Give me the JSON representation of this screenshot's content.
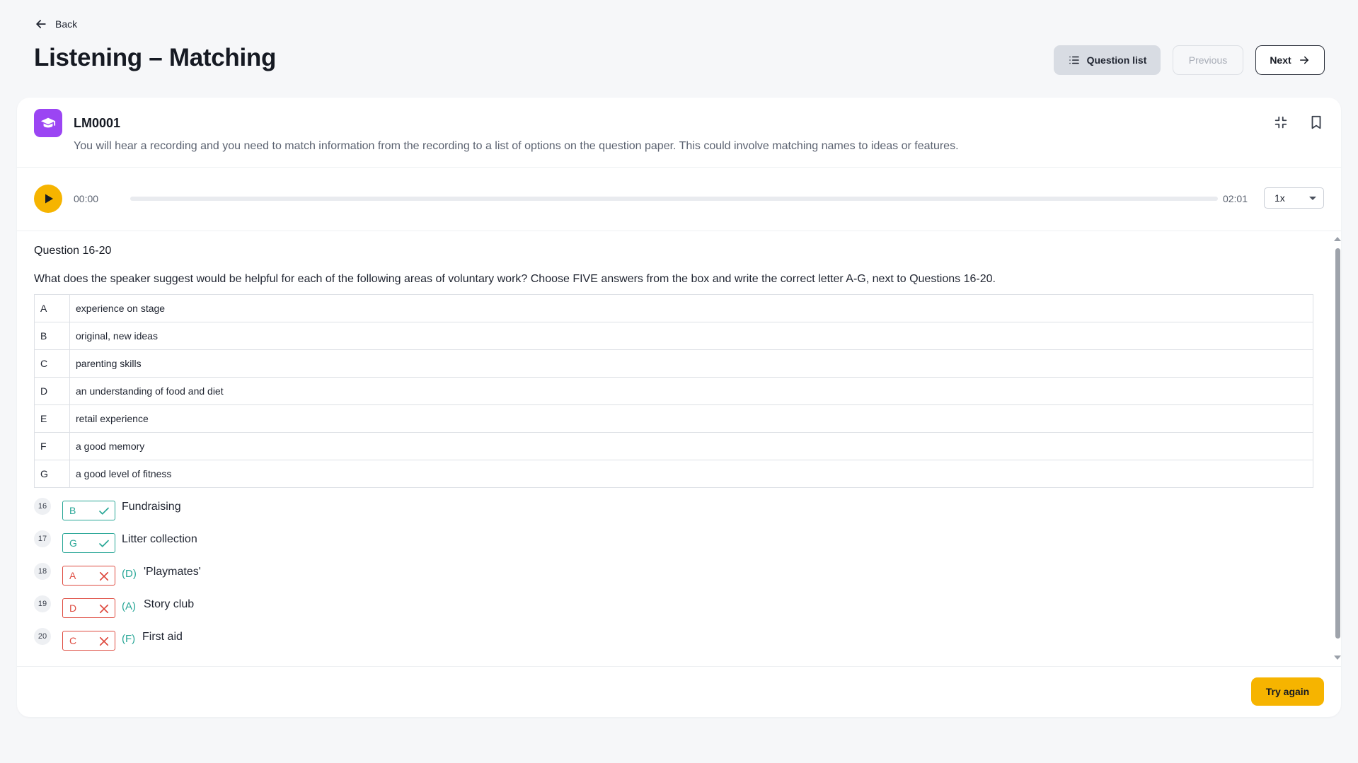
{
  "header": {
    "back_label": "Back",
    "title": "Listening – Matching",
    "question_list_label": "Question list",
    "previous_label": "Previous",
    "next_label": "Next"
  },
  "card": {
    "code": "LM0001",
    "description": "You will hear a recording and you need to match information from the recording to a list of options on the question paper. This could involve matching names to ideas or features.",
    "badge_color": "#9b45f3"
  },
  "audio": {
    "current_time": "00:00",
    "duration": "02:01",
    "progress": 0,
    "speed": "1x"
  },
  "question": {
    "range_label": "Question 16-20",
    "instruction": "What does the speaker suggest would be helpful for each of the following areas of voluntary work? Choose FIVE answers from the box and write the correct letter A-G, next to Questions 16-20.",
    "options": [
      {
        "letter": "A",
        "text": "experience on stage"
      },
      {
        "letter": "B",
        "text": "original, new ideas"
      },
      {
        "letter": "C",
        "text": "parenting skills"
      },
      {
        "letter": "D",
        "text": "an understanding of food and diet"
      },
      {
        "letter": "E",
        "text": "retail experience"
      },
      {
        "letter": "F",
        "text": "a good memory"
      },
      {
        "letter": "G",
        "text": "a good level of fitness"
      }
    ],
    "answers": [
      {
        "number": "16",
        "given": "B",
        "correct": true,
        "correction": "",
        "label": "Fundraising"
      },
      {
        "number": "17",
        "given": "G",
        "correct": true,
        "correction": "",
        "label": "Litter collection"
      },
      {
        "number": "18",
        "given": "A",
        "correct": false,
        "correction": "(D)",
        "label": "'Playmates'"
      },
      {
        "number": "19",
        "given": "D",
        "correct": false,
        "correction": "(A)",
        "label": "Story club"
      },
      {
        "number": "20",
        "given": "C",
        "correct": false,
        "correction": "(F)",
        "label": "First aid"
      }
    ]
  },
  "footer": {
    "try_again_label": "Try again"
  },
  "colors": {
    "accent": "#f6b400",
    "correct": "#27a696",
    "incorrect": "#de4a3f"
  }
}
